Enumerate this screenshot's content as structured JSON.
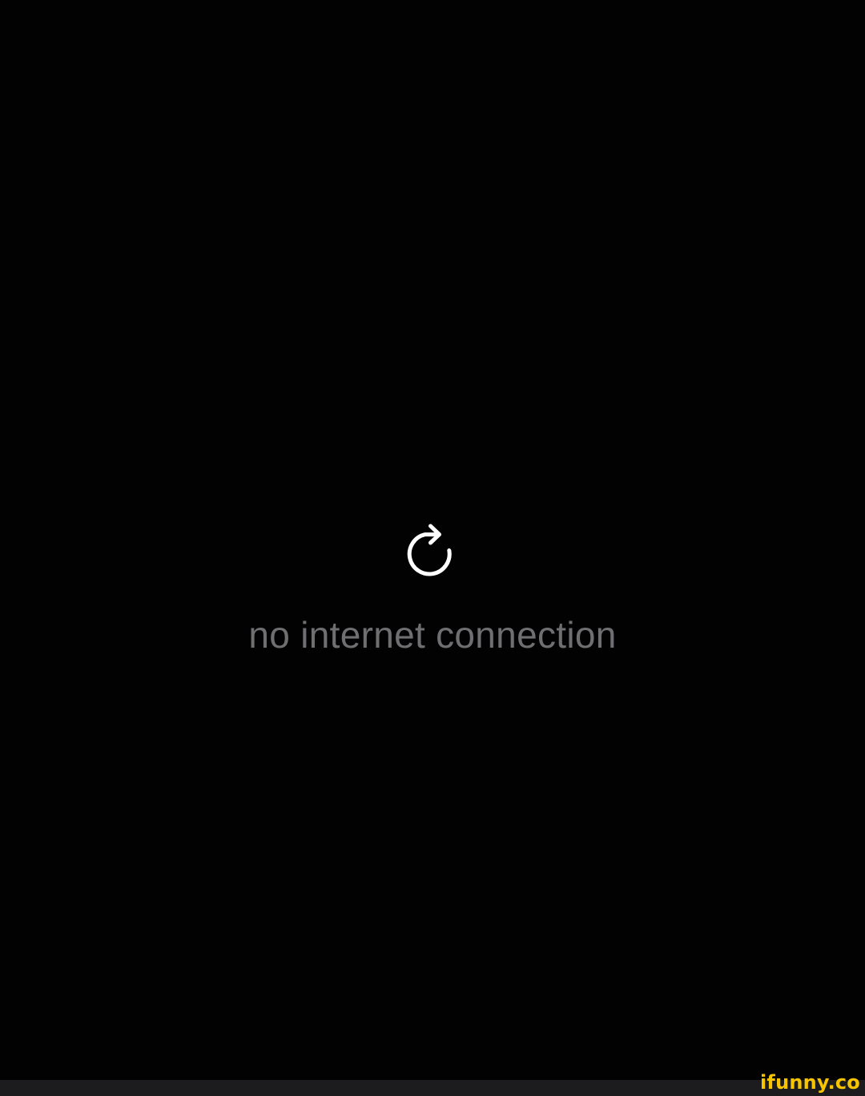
{
  "screen": {
    "background_color": "#020203",
    "reload": {
      "icon": "reload-icon",
      "icon_color": "#ffffff"
    },
    "message": {
      "text": "no internet connection",
      "color": "#6f6f72"
    }
  },
  "watermark": {
    "text": "ifunny.co",
    "color": "#f6c400"
  }
}
